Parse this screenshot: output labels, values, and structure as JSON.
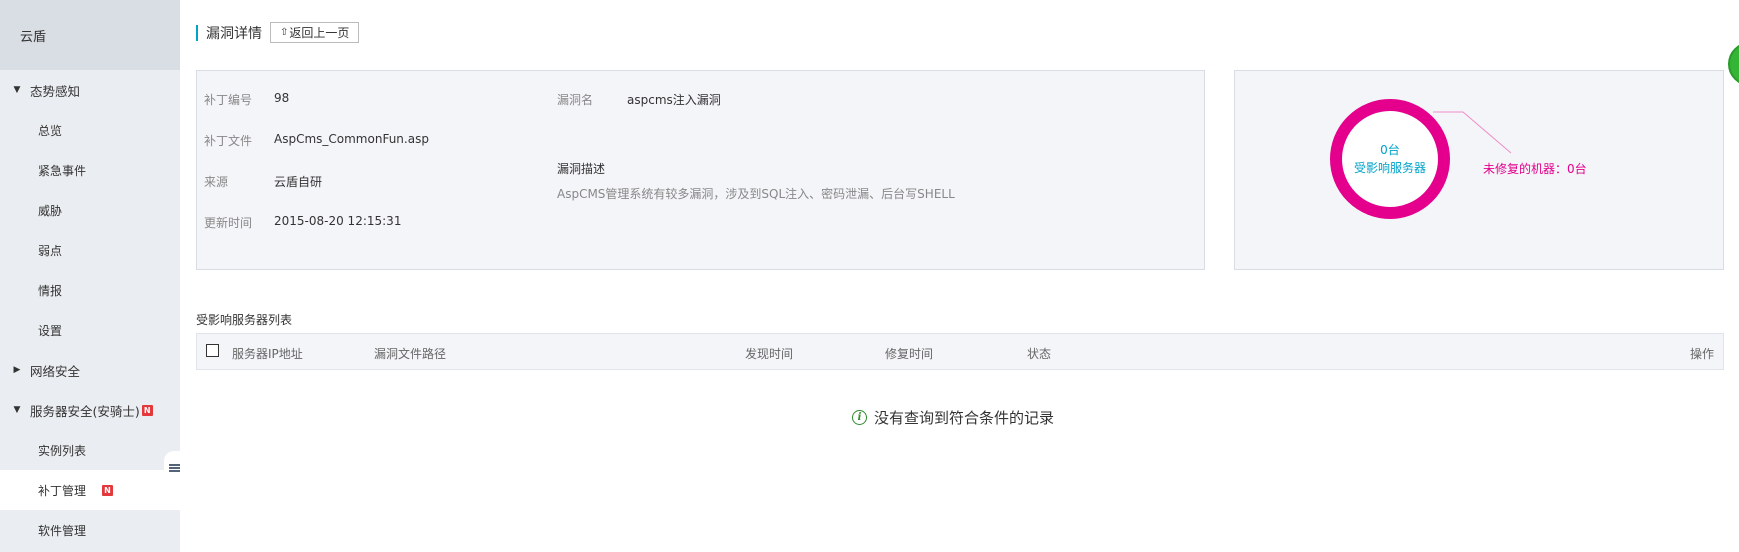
{
  "sidebar": {
    "header": "云盾",
    "groups": [
      {
        "label": "态势感知",
        "expanded": true,
        "items": [
          "总览",
          "紧急事件",
          "威胁",
          "弱点",
          "情报",
          "设置"
        ]
      },
      {
        "label": "网络安全",
        "expanded": false
      },
      {
        "label": "服务器安全(安骑士)",
        "expanded": true,
        "badge": "N",
        "items": [
          "实例列表",
          "补丁管理",
          "软件管理"
        ]
      }
    ],
    "active_item": "补丁管理",
    "active_badge": "N"
  },
  "page": {
    "title": "漏洞详情",
    "back_label": "返回上一页"
  },
  "info": {
    "patch_no_label": "补丁编号",
    "patch_no": "98",
    "patch_file_label": "补丁文件",
    "patch_file": "AspCms_CommonFun.asp",
    "source_label": "来源",
    "source": "云盾自研",
    "updated_label": "更新时间",
    "updated": "2015-08-20 12:15:31",
    "vuln_name_label": "漏洞名",
    "vuln_name": "aspcms注入漏洞",
    "desc_label": "漏洞描述",
    "desc": "AspCMS管理系统有较多漏洞，涉及到SQL注入、密码泄漏、后台写SHELL"
  },
  "stats": {
    "affected_count": "0台",
    "affected_label": "受影响服务器",
    "unfixed_text": "未修复的机器：0台",
    "ring_color": "#e4008c",
    "text_color": "#00a2ca"
  },
  "table": {
    "title": "受影响服务器列表",
    "columns": [
      "服务器IP地址",
      "漏洞文件路径",
      "发现时间",
      "修复时间",
      "状态",
      "操作"
    ],
    "empty_text": "没有查询到符合条件的记录"
  }
}
